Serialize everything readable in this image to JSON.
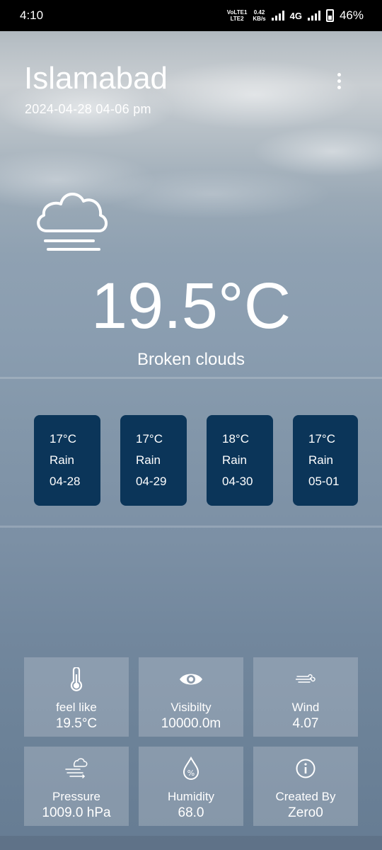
{
  "status_bar": {
    "time": "4:10",
    "network_label_top": "VoLTE1",
    "network_label_bottom": "LTE2",
    "speed_value": "0.42",
    "speed_unit": "KB/s",
    "network_type": "4G",
    "battery": "46%"
  },
  "header": {
    "city": "Islamabad",
    "datetime": "2024-04-28 04-06 pm",
    "menu_icon": "more-vert-icon"
  },
  "current": {
    "icon": "cloud-fog-icon",
    "temperature": "19.5°C",
    "description": "Broken clouds"
  },
  "forecast": [
    {
      "temp": "17°C",
      "condition": "Rain",
      "date": "04-28"
    },
    {
      "temp": "17°C",
      "condition": "Rain",
      "date": "04-29"
    },
    {
      "temp": "18°C",
      "condition": "Rain",
      "date": "04-30"
    },
    {
      "temp": "17°C",
      "condition": "Rain",
      "date": "05-01"
    }
  ],
  "details": [
    {
      "icon": "thermometer-icon",
      "label": "feel like",
      "value": "19.5°C"
    },
    {
      "icon": "eye-icon",
      "label": "Visibilty",
      "value": "10000.0m"
    },
    {
      "icon": "wind-icon",
      "label": "Wind",
      "value": "4.07"
    },
    {
      "icon": "pressure-icon",
      "label": "Pressure",
      "value": "1009.0 hPa"
    },
    {
      "icon": "humidity-icon",
      "label": "Humidity",
      "value": "68.0"
    },
    {
      "icon": "info-icon",
      "label": "Created By",
      "value": "Zero0"
    }
  ],
  "colors": {
    "card_background": "#0b3559",
    "tile_background": "#9aa6b3"
  }
}
